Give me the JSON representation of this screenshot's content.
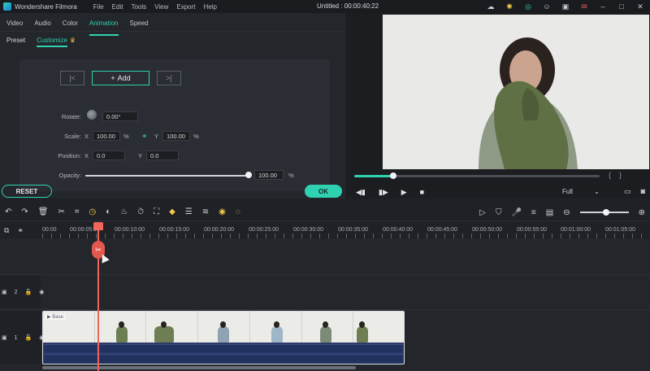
{
  "app": {
    "name": "Wondershare Filmora",
    "project_title": "Untitled : 00:00:40:22"
  },
  "menu": [
    "File",
    "Edit",
    "Tools",
    "View",
    "Export",
    "Help"
  ],
  "title_icons": [
    "cloud-icon",
    "bulb-icon",
    "support-icon",
    "user-icon",
    "save-icon",
    "mail-icon",
    "minimize-icon",
    "maximize-icon",
    "close-icon"
  ],
  "tabs": [
    "Video",
    "Audio",
    "Color",
    "Animation",
    "Speed"
  ],
  "active_tab": "Animation",
  "subtabs": [
    "Preset",
    "Customize"
  ],
  "active_subtab": "Customize",
  "keyframe": {
    "add_label": "Add"
  },
  "props": {
    "rotate": {
      "label": "Rotate:",
      "value": "0.00°"
    },
    "scale": {
      "label": "Scale:",
      "x_axis": "X",
      "x_value": "100.00",
      "y_axis": "Y",
      "y_value": "100.00",
      "unit": "%"
    },
    "position": {
      "label": "Position:",
      "x_axis": "X",
      "x_value": "0.0",
      "y_axis": "Y",
      "y_value": "0.0"
    },
    "opacity": {
      "label": "Opacity:",
      "value": "100.00",
      "unit": "%",
      "level": 1.0
    }
  },
  "buttons": {
    "reset": "RESET",
    "ok": "OK"
  },
  "preview": {
    "quality": "Full",
    "progress": 0.16
  },
  "timeline": {
    "ruler_labels": [
      "00:00",
      "00:00:05:00",
      "00:00:10:00",
      "00:00:15:00",
      "00:00:20:00",
      "00:00:25:00",
      "00:00:30:00",
      "00:00:35:00",
      "00:00:40:00",
      "00:00:45:00",
      "00:00:50:00",
      "00:00:55:00",
      "00:01:00:00",
      "00:01:05:00"
    ],
    "tracks": [
      {
        "number": "2"
      },
      {
        "number": "1",
        "clip_label": "Base"
      }
    ]
  },
  "colors": {
    "accent": "#2fd2b0",
    "playhead": "#f0655a",
    "clip": "#2d3a6a"
  }
}
